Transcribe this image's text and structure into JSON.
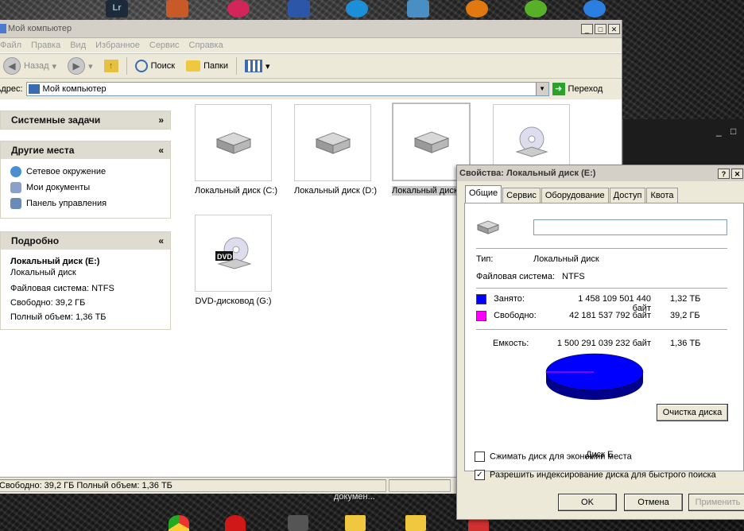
{
  "window": {
    "title": "Мой компьютер",
    "menu": [
      "Файл",
      "Правка",
      "Вид",
      "Избранное",
      "Сервис",
      "Справка"
    ],
    "toolbar": {
      "back": "Назад",
      "search": "Поиск",
      "folders": "Папки"
    },
    "address": {
      "label": "Адрес:",
      "value": "Мой компьютер",
      "go": "Переход"
    }
  },
  "sidebar": {
    "system_tasks": "Системные задачи",
    "other_places": {
      "title": "Другие места",
      "items": [
        "Сетевое окружение",
        "Мои документы",
        "Панель управления"
      ]
    },
    "details": {
      "title": "Подробно",
      "name": "Локальный диск (E:)",
      "type": "Локальный диск",
      "fs": "Файловая система: NTFS",
      "free": "Свободно: 39,2 ГБ",
      "total": "Полный объем: 1,36 ТБ"
    }
  },
  "drives": [
    {
      "label": "Локальный диск (C:)",
      "icon": "hard-drive"
    },
    {
      "label": "Локальный диск (D:)",
      "icon": "hard-drive"
    },
    {
      "label": "Локальный диск",
      "icon": "hard-drive",
      "selected": true
    },
    {
      "label": "",
      "icon": "cd-drive"
    },
    {
      "label": "DVD-дисковод (G:)",
      "icon": "dvd-drive"
    }
  ],
  "statusbar": {
    "text": "Свободно: 39,2 ГБ Полный объем: 1,36 ТБ"
  },
  "desktop": {
    "label": "докумен..."
  },
  "dialog": {
    "title": "Свойства: Локальный диск (E:)",
    "tabs": [
      "Общие",
      "Сервис",
      "Оборудование",
      "Доступ",
      "Квота"
    ],
    "name_value": "",
    "type_label": "Тип:",
    "type_value": "Локальный диск",
    "fs_label": "Файловая система:",
    "fs_value": "NTFS",
    "used": {
      "label": "Занято:",
      "bytes": "1 458 109 501 440 байт",
      "size": "1,32 ТБ",
      "color": "#0000ff"
    },
    "free": {
      "label": "Свободно:",
      "bytes": "42 181 537 792 байт",
      "size": "39,2 ГБ",
      "color": "#ff00ff"
    },
    "capacity": {
      "label": "Емкость:",
      "bytes": "1 500 291 039 232 байт",
      "size": "1,36 ТБ"
    },
    "disk_label": "Диск E",
    "cleanup": "Очистка диска",
    "compress": "Сжимать диск для экономии места",
    "index": "Разрешить индексирование диска для быстрого поиска",
    "ok": "OK",
    "cancel": "Отмена",
    "apply": "Применить"
  }
}
